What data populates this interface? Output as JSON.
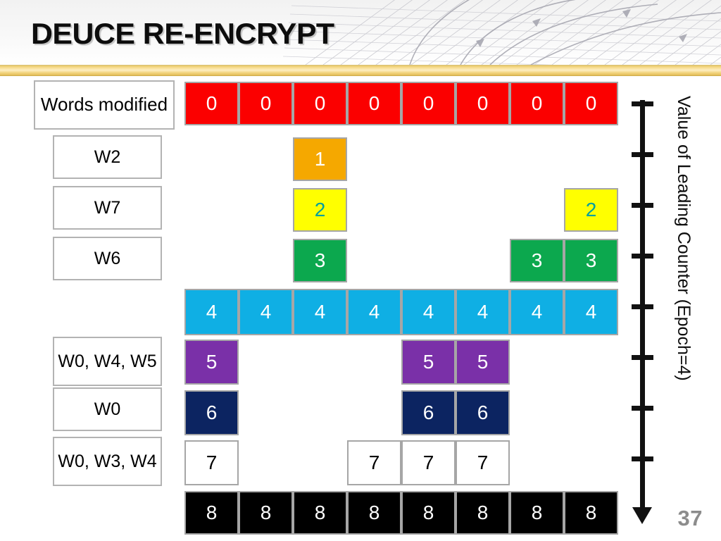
{
  "header": {
    "title": "DEUCE RE-ENCRYPT",
    "gold_bar_color": "#f0d versions"
  },
  "slide": {
    "number": "37"
  },
  "axis": {
    "caption": "Value of Leading Counter (Epoch=4)",
    "tick_count": 8,
    "arrow_direction": "down"
  },
  "labels": [
    {
      "text": "Words modified",
      "row": 0,
      "wide": true
    },
    {
      "text": "W2",
      "row": 1,
      "wide": false
    },
    {
      "text": "W7",
      "row": 2,
      "wide": false
    },
    {
      "text": "W6",
      "row": 3,
      "wide": false
    },
    {
      "text": "W0, W4, W5",
      "row": 5,
      "wide": false
    },
    {
      "text": "W0",
      "row": 6,
      "wide": false
    },
    {
      "text": "W0, W3, W4",
      "row": 7,
      "wide": false
    }
  ],
  "chart_data": {
    "type": "heatmap",
    "title": "DEUCE RE-ENCRYPT",
    "xlabel": "",
    "ylabel": "Value of Leading Counter (Epoch=4)",
    "columns": 8,
    "rows": 9,
    "row_values": [
      0,
      1,
      2,
      3,
      4,
      5,
      6,
      7,
      8
    ],
    "row_colors": [
      "#fb0000",
      "#f5a800",
      "#ffff00",
      "#0ca84e",
      "#0fafe4",
      "#7a30a8",
      "#0c2461",
      "#ffffff",
      "#000000"
    ],
    "row_text_colors": [
      "#ffffff",
      "#ffffff",
      "#00a0a0",
      "#ffffff",
      "#ffffff",
      "#ffffff",
      "#ffffff",
      "#000000",
      "#ffffff"
    ],
    "rows_detail": [
      {
        "value": "0",
        "label": "Words modified",
        "columns": [
          0,
          1,
          2,
          3,
          4,
          5,
          6,
          7
        ],
        "color": "#fb0000",
        "text_color": "#ffffff"
      },
      {
        "value": "1",
        "label": "W2",
        "columns": [
          2
        ],
        "color": "#f5a800",
        "text_color": "#ffffff"
      },
      {
        "value": "2",
        "label": "W7",
        "columns": [
          2,
          7
        ],
        "color": "#ffff00",
        "text_color": "#00a0a0"
      },
      {
        "value": "3",
        "label": "W6",
        "columns": [
          2,
          6,
          7
        ],
        "color": "#0ca84e",
        "text_color": "#ffffff"
      },
      {
        "value": "4",
        "label": "",
        "columns": [
          0,
          1,
          2,
          3,
          4,
          5,
          6,
          7
        ],
        "color": "#0fafe4",
        "text_color": "#ffffff"
      },
      {
        "value": "5",
        "label": "W0, W4, W5",
        "columns": [
          0,
          4,
          5
        ],
        "color": "#7a30a8",
        "text_color": "#ffffff"
      },
      {
        "value": "6",
        "label": "W0",
        "columns": [
          0,
          4,
          5
        ],
        "color": "#0c2461",
        "text_color": "#ffffff"
      },
      {
        "value": "7",
        "label": "W0, W3, W4",
        "columns": [
          0,
          3,
          4,
          5
        ],
        "color": "#ffffff",
        "text_color": "#000000"
      },
      {
        "value": "8",
        "label": "",
        "columns": [
          0,
          1,
          2,
          3,
          4,
          5,
          6,
          7
        ],
        "color": "#000000",
        "text_color": "#ffffff"
      }
    ]
  }
}
